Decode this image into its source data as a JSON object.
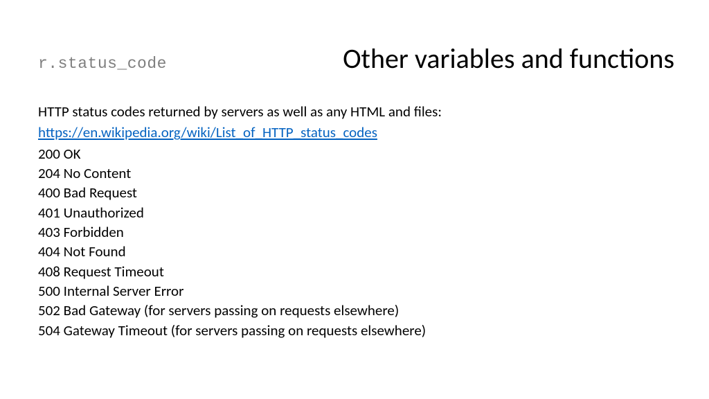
{
  "header": {
    "code_label": "r.status_code",
    "title": "Other variables and functions"
  },
  "intro": "HTTP status codes returned by servers as well as any HTML and files:",
  "link": {
    "text": "https://en.wikipedia.org/wiki/List_of_HTTP_status_codes",
    "href": "https://en.wikipedia.org/wiki/List_of_HTTP_status_codes"
  },
  "status_codes": [
    "200 OK",
    "204 No Content",
    "400 Bad Request",
    "401 Unauthorized",
    "403 Forbidden",
    "404 Not Found",
    "408 Request Timeout",
    "500 Internal Server Error",
    "502 Bad Gateway (for servers passing on requests elsewhere)",
    "504 Gateway Timeout (for servers passing on requests elsewhere)"
  ]
}
